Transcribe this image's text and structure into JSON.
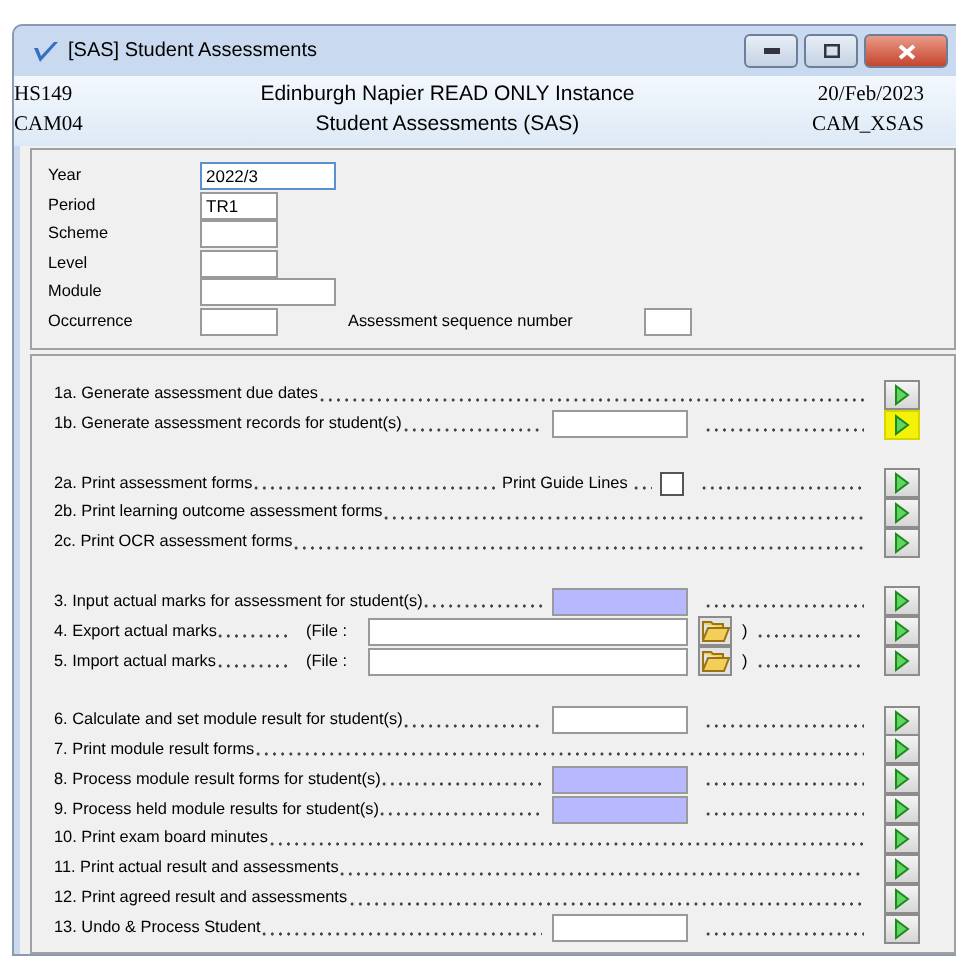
{
  "window": {
    "title": "[SAS] Student Assessments"
  },
  "header": {
    "left": [
      "HS149",
      "CAM04"
    ],
    "center": [
      "Edinburgh Napier READ ONLY Instance",
      "Student Assessments (SAS)"
    ],
    "right": [
      "20/Feb/2023",
      "CAM_XSAS"
    ]
  },
  "form_fields": [
    {
      "label": "Year",
      "value": "2022/3",
      "kind": "wide",
      "focused": true
    },
    {
      "label": "Period",
      "value": "TR1",
      "kind": "short",
      "focused": false
    },
    {
      "label": "Scheme",
      "kind": "short",
      "focused": false
    },
    {
      "label": "Level",
      "kind": "short",
      "focused": false
    },
    {
      "label": "Module",
      "kind": "wide",
      "focused": false
    },
    {
      "label": "Occurrence",
      "kind": "short",
      "focused": false
    }
  ],
  "sequence_field": {
    "label": "Assessment sequence number"
  },
  "action_groups": [
    [
      {
        "kind": "plain",
        "label": "1a. Generate assessment due dates",
        "highlighted": false
      },
      {
        "kind": "field",
        "label": "1b. Generate assessment records for student(s)",
        "shaded": false,
        "highlighted": true
      }
    ],
    [
      {
        "kind": "checkbox",
        "label": "2a. Print assessment forms",
        "option": "Print Guide Lines",
        "checked": false,
        "highlighted": false
      },
      {
        "kind": "plain",
        "label": "2b. Print learning outcome assessment forms",
        "highlighted": false
      },
      {
        "kind": "plain",
        "label": "2c. Print OCR assessment forms",
        "highlighted": false
      }
    ],
    [
      {
        "kind": "field",
        "label": "3. Input actual marks for assessment for student(s)",
        "shaded": true,
        "highlighted": false
      },
      {
        "kind": "file",
        "label": "4. Export actual marks",
        "file_label": "(File :",
        "close": ")",
        "highlighted": false
      },
      {
        "kind": "file",
        "label": "5. Import actual marks",
        "file_label": "(File :",
        "close": ")",
        "highlighted": false
      }
    ],
    [
      {
        "kind": "field",
        "label": "6. Calculate and set module result for student(s)",
        "shaded": false,
        "highlighted": false
      },
      {
        "kind": "plain",
        "label": "7. Print module result forms",
        "highlighted": false
      },
      {
        "kind": "field",
        "label": "8. Process module result forms for student(s)",
        "shaded": true,
        "highlighted": false
      },
      {
        "kind": "field",
        "label": "9. Process held module results for student(s)",
        "shaded": true,
        "highlighted": false
      },
      {
        "kind": "plain",
        "label": "10. Print exam board minutes",
        "highlighted": false
      },
      {
        "kind": "plain",
        "label": "11. Print actual result and assessments",
        "highlighted": false
      },
      {
        "kind": "plain",
        "label": "12. Print agreed result and assessments",
        "highlighted": false
      },
      {
        "kind": "field",
        "label": "13. Undo & Process Student",
        "shaded": false,
        "highlighted": false
      }
    ]
  ]
}
